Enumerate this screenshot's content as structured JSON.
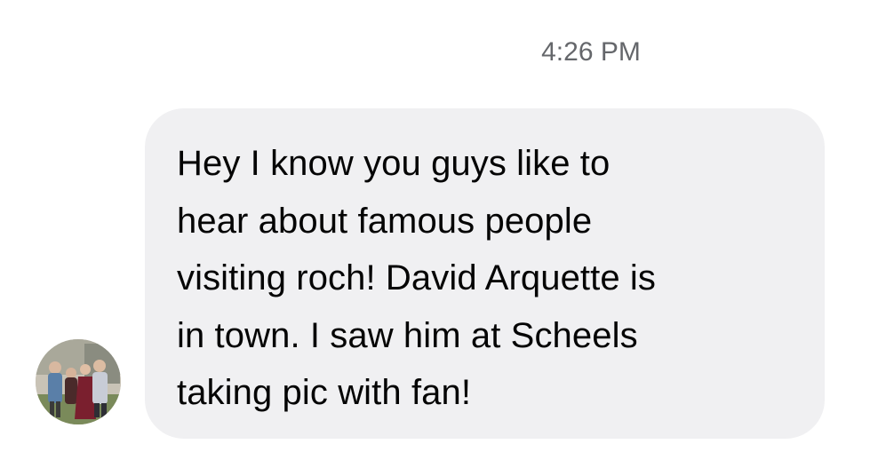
{
  "thread": {
    "timestamp": "4:26 PM"
  },
  "message": {
    "sender_avatar_icon": "user-avatar-photo",
    "lines": [
      "Hey I know you guys like to",
      "hear about famous people",
      "visiting roch! David Arquette is",
      "in town. I saw him at Scheels",
      "taking pic with fan!"
    ]
  },
  "colors": {
    "bubble_background": "#f0f0f2",
    "message_text": "#050505",
    "timestamp_text": "#65676b"
  }
}
